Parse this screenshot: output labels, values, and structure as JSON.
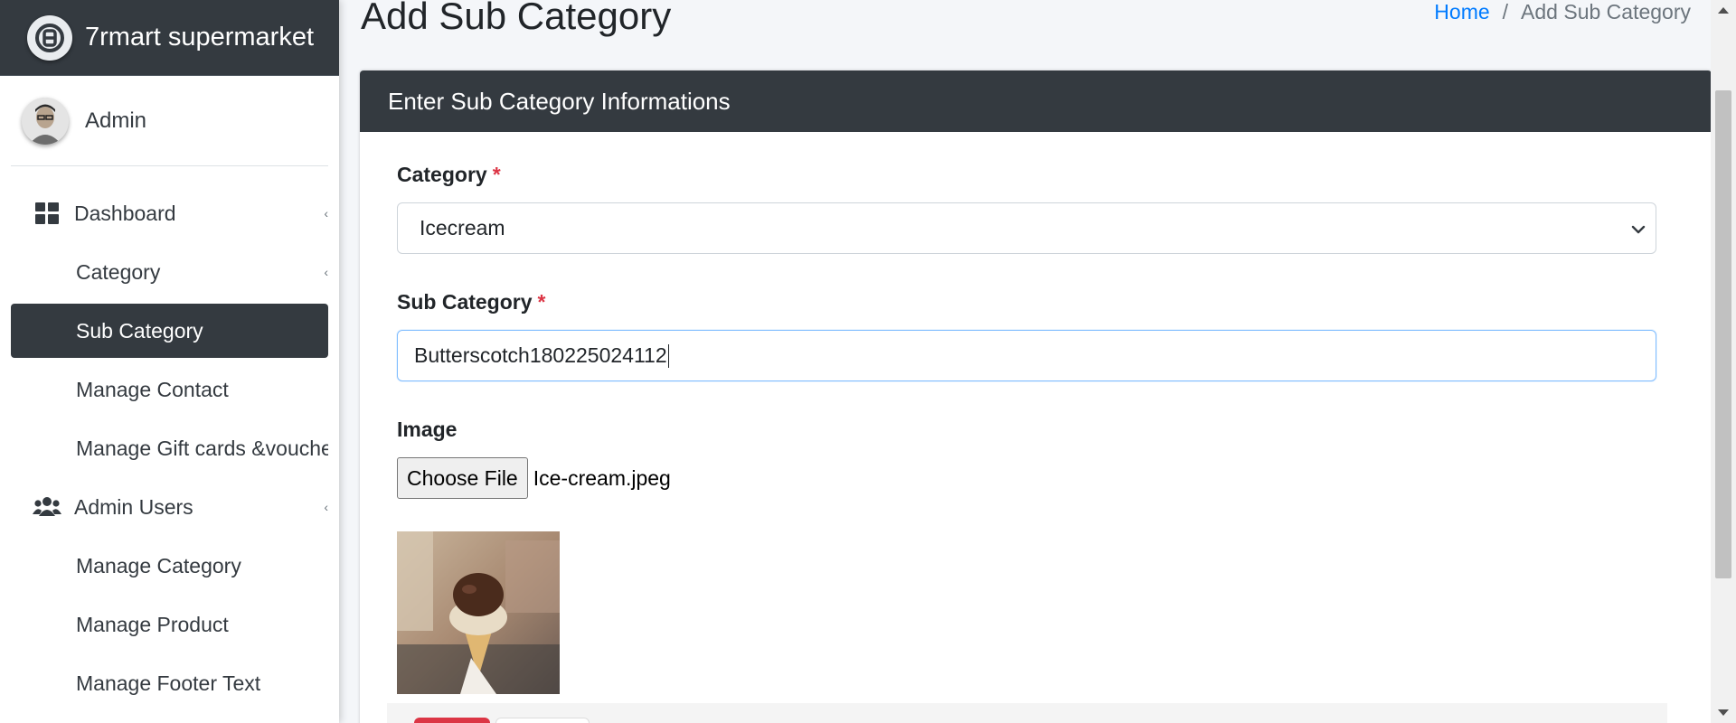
{
  "brand": {
    "name": "7rmart supermarket"
  },
  "user": {
    "name": "Admin"
  },
  "sidebar": {
    "items": [
      {
        "label": "Dashboard",
        "icon": "dashboard-icon"
      },
      {
        "label": "Category"
      },
      {
        "label": "Sub Category",
        "active": true
      },
      {
        "label": "Manage Contact"
      },
      {
        "label": "Manage Gift cards &voucher"
      },
      {
        "label": "Admin Users",
        "icon": "users-icon"
      },
      {
        "label": "Manage Category"
      },
      {
        "label": "Manage Product"
      },
      {
        "label": "Manage Footer Text"
      }
    ]
  },
  "page": {
    "title": "Add Sub Category",
    "breadcrumb": {
      "home": "Home",
      "separator": "/",
      "current": "Add Sub Category"
    }
  },
  "form": {
    "header": "Enter Sub Category Informations",
    "category": {
      "label": "Category",
      "required_mark": "*",
      "selected": "Icecream"
    },
    "sub_category": {
      "label": "Sub Category",
      "required_mark": "*",
      "value": "Butterscotch180225024112"
    },
    "image": {
      "label": "Image",
      "button": "Choose File",
      "file_name": "Ice-cream.jpeg"
    }
  },
  "colors": {
    "sidebar_dark": "#343a40",
    "link": "#007bff",
    "required": "#dc3545",
    "focus_border": "#80bdff"
  }
}
